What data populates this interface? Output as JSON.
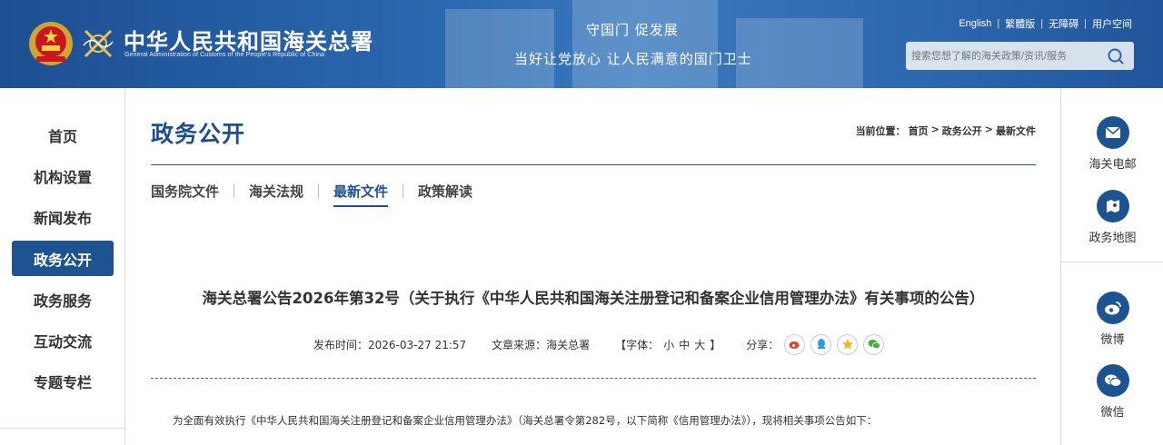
{
  "header": {
    "site_title": "中华人民共和国海关总署",
    "site_subtitle": "General Administration of Customs of the People's Republic of China",
    "slogan_line1": "守国门   促发展",
    "slogan_line2": "当好让党放心   让人民满意的国门卫士",
    "links": [
      "English",
      "繁體版",
      "无障碍",
      "用户空间"
    ],
    "search_placeholder": "搜索您想了解的海关政策/资讯/服务",
    "brand_color": "#1d4f92"
  },
  "leftnav": {
    "items": [
      "首页",
      "机构设置",
      "新闻发布",
      "政务公开",
      "政务服务",
      "互动交流",
      "专题专栏"
    ],
    "active": "政务公开"
  },
  "rightbar": {
    "items": [
      {
        "label": "海关电邮",
        "icon": "mail-icon"
      },
      {
        "label": "政务地图",
        "icon": "map-icon"
      },
      {
        "label": "微博",
        "icon": "weibo-icon"
      },
      {
        "label": "微信",
        "icon": "wechat-icon"
      }
    ]
  },
  "main": {
    "section_title": "政务公开",
    "breadcrumb_label": "当前位置：",
    "breadcrumb": [
      "首页",
      "政务公开",
      "最新文件"
    ],
    "breadcrumb_sep": ">",
    "tabs": [
      "国务院文件",
      "海关法规",
      "最新文件",
      "政策解读"
    ],
    "active_tab": "最新文件",
    "article_title": "海关总署公告2026年第32号（关于执行《中华人民共和国海关注册登记和备案企业信用管理办法》有关事项的公告）",
    "publish_time": "发布时间：2026-03-27 21:57",
    "source": "文章来源：海关总署",
    "font_label_open": "【字体：",
    "font_small": "小",
    "font_medium": "中",
    "font_large": "大",
    "font_label_close": "】",
    "share_label": "分享：",
    "share_icons": [
      "weibo-share-icon",
      "qq-share-icon",
      "qzone-share-icon",
      "wechat-share-icon"
    ],
    "lead_text": "为全面有效执行《中华人民共和国海关注册登记和备案企业信用管理办法》（海关总署令第282号，以下简称《信用管理办法》），现将相关事项公告如下："
  }
}
